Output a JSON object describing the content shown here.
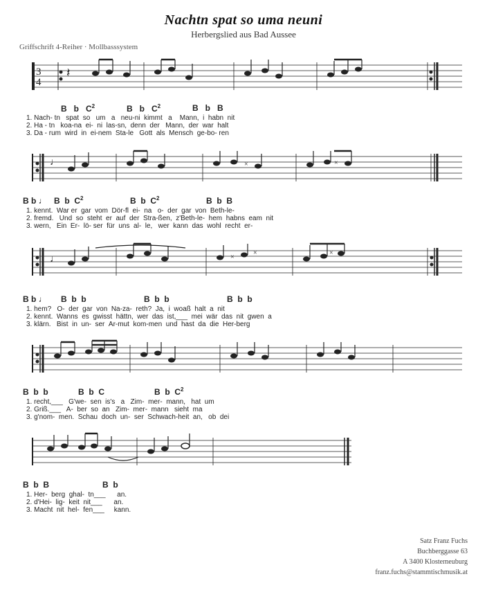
{
  "title": "Nachtn spat so uma neuni",
  "subtitle": "Herbergslied aus Bad Aussee",
  "griffschrift_label": "Griffschrift 4-Reiher · Mollbasssystem",
  "footer": {
    "line1": "Satz Franz Fuchs",
    "line2": "Buchberggasse 63",
    "line3": "A 3400 Klosterneuburg",
    "line4": "franz.fuchs@stammtischmusik.at"
  },
  "staves": [
    {
      "chords": [
        "",
        "B",
        "b",
        "C²",
        "B",
        "b",
        "C²",
        "B",
        "b",
        "B"
      ],
      "lyrics": [
        "1. Nach-  tn   spat  so  um  a   neu-ni  kimmt  a    Mann,  i  habn  nit",
        "2. Ha -  tn   koa-na  ei-  ni  las-sn,  denn  der   Mann,  der  war  halt",
        "3. Da -  rum  wird  in  ei-nem  Sta-le   Gott   als  Mensch  ge- bo-  ren"
      ]
    },
    {
      "chords": [
        "B",
        "b",
        "♩",
        "B",
        "b",
        "C²",
        "B",
        "b",
        "C²",
        "B",
        "b",
        "B"
      ],
      "lyrics": [
        "1. kennt.  War er  gar  vom  Dör-fl  ei-  na   o-  der  gar  von  Beth-le-",
        "2. fremd.   Und  so  steht  er  auf  der  Stra-ßen,  z'Beth-le-  hem  habns  eam  nit",
        "3. wern,   Ein  Er-  lö- ser  für  uns  al-  le,   wer  kann  das  wohl  recht  er-"
      ]
    },
    {
      "chords": [
        "B",
        "b",
        "♩",
        "B",
        "b",
        "b",
        "B",
        "b",
        "b",
        "B",
        "b",
        "b"
      ],
      "lyrics": [
        "1. hem?   O-  der  gar  von  Na-za-  reth?  Ja,  i  woaß  halt  a  nit",
        "2. kennt.  Wanns  es  gwisst  hättn,  wer  das  ist,___  mei  wär  das  nit  gwen  a",
        "3. klärn.  Bist  in  un-  ser  Ar-mut  kom-men  und  hast  da  die  Her-berg"
      ]
    },
    {
      "chords": [
        "B",
        "b",
        "b",
        "B",
        "b",
        "C",
        "B",
        "b",
        "C²"
      ],
      "lyrics": [
        "1. recht,___   G'we-  sen  is's  a   Zim-  mer-  mann,   hat  um",
        "2. Griß.___   A-  ber  so  an   Zim-  mer-  mann   sieht  ma",
        "3. g'nom-  men.  Schau  doch  un-  ser  Schwach-heit  an,   ob  dei"
      ]
    },
    {
      "chords": [
        "B",
        "b",
        "B",
        "",
        "B",
        "b"
      ],
      "lyrics": [
        "1. Her-  berg  ghal-  tn___   an.",
        "2. d'Hei-  lig-  keit  nit___   an.",
        "3. Macht  nit  hel-  fen___   kann."
      ]
    }
  ]
}
